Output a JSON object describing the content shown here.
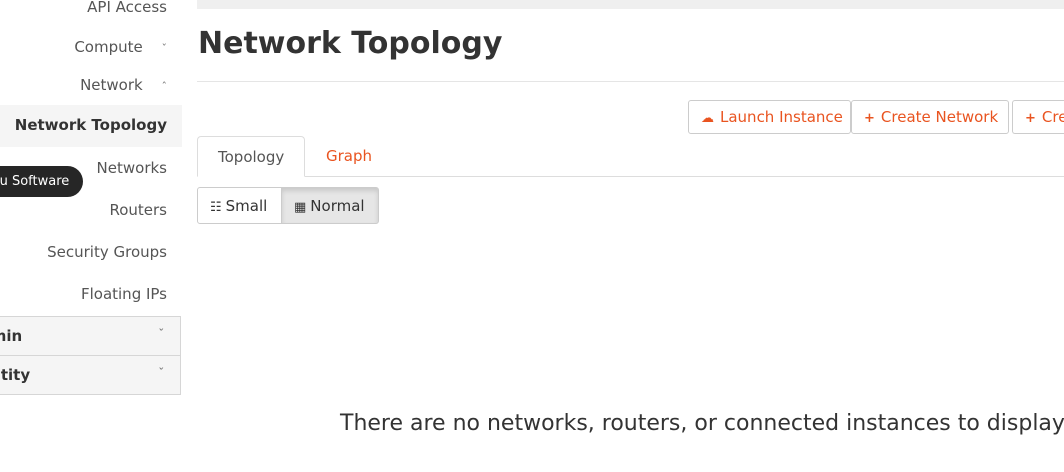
{
  "sidebar": {
    "items": [
      {
        "label": "API Access"
      },
      {
        "label": "Compute",
        "chevron": "chevron-down-icon"
      },
      {
        "label": "Network",
        "chevron": "chevron-up-icon"
      },
      {
        "label": "Network Topology",
        "active": true
      },
      {
        "label": "Networks"
      },
      {
        "label": "Routers"
      },
      {
        "label": "Security Groups"
      },
      {
        "label": "Floating IPs"
      }
    ],
    "panels": [
      {
        "label": "dmin",
        "chevron": "chevron-down-icon"
      },
      {
        "label": "entity",
        "chevron": "chevron-down-icon"
      }
    ],
    "tooltip": "untu Software"
  },
  "main": {
    "title": "Network Topology",
    "actions": [
      {
        "label": "Launch Instance",
        "icon": "cloud-upload-icon"
      },
      {
        "label": "Create Network",
        "icon": "plus-icon"
      },
      {
        "label": "Cre",
        "icon": "plus-icon"
      }
    ],
    "tabs": [
      {
        "label": "Topology",
        "active": true
      },
      {
        "label": "Graph",
        "active": false
      }
    ],
    "size_toggle": [
      {
        "label": "Small",
        "icon": "grid-small-icon",
        "active": false
      },
      {
        "label": "Normal",
        "icon": "grid-normal-icon",
        "active": true
      }
    ],
    "empty_message": "There are no networks, routers, or connected instances to display."
  },
  "colors": {
    "accent": "#e95420",
    "tooltip_bg": "#262626",
    "active_bg": "#f5f5f5"
  }
}
